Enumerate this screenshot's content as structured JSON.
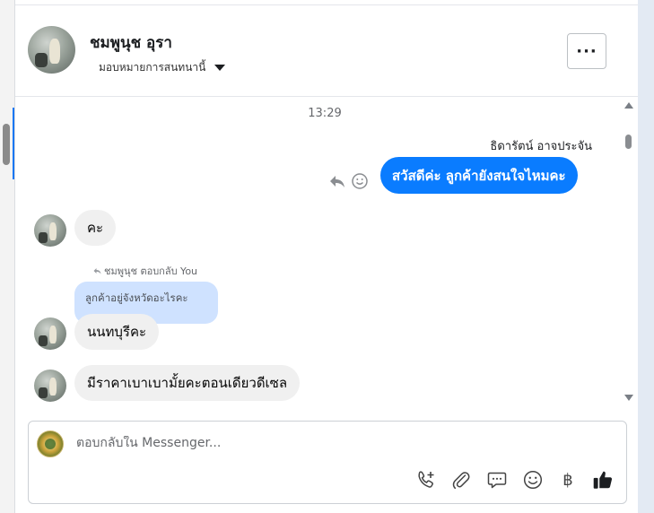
{
  "header": {
    "contact_name": "ชมพูนุช อุรา",
    "assign_label": "มอบหมายการสนทนานี้",
    "more_label": "···"
  },
  "chat": {
    "timestamp": "13:29",
    "outgoing": {
      "sender": "ธิดารัตน์ อาจประจัน",
      "text": "สวัสดีค่ะ ลูกค้ายังสนใจไหมคะ"
    },
    "incoming_1": "คะ",
    "reply_label": "ชมพูนุช ตอบกลับ You",
    "quoted_text": "ลูกค้าอยู่จังหวัดอะไรคะ",
    "incoming_2": "นนทบุรีคะ",
    "incoming_3": "มีราคาเบาเบามั้ยคะตอนเดียวดีเซล"
  },
  "composer": {
    "placeholder": "ตอบกลับใน Messenger...",
    "value": ""
  },
  "tools": {
    "baht_symbol": "฿"
  },
  "colors": {
    "outgoing_bubble": "#0a7cff",
    "incoming_bubble": "#f0f0f0",
    "quoted_bubble": "#cfe2ff"
  }
}
